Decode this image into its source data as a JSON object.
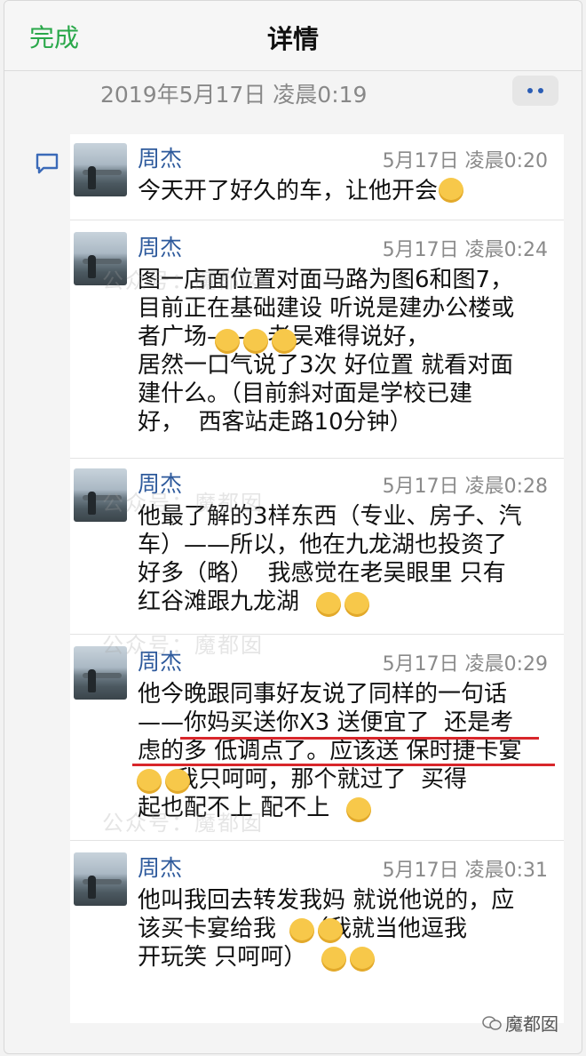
{
  "nav": {
    "done": "完成",
    "title": "详情"
  },
  "header": {
    "date": "2019年5月17日 凌晨0:19"
  },
  "messages": [
    {
      "name": "周杰",
      "time": "5月17日 凌晨0:20",
      "text": "今天开了好久的车，让他开会"
    },
    {
      "name": "周杰",
      "time": "5月17日 凌晨0:24",
      "text": "图一店面位置对面马路为图6和图7，\n目前正在基础建设 听说是建办公楼或\n者广场——  老吴难得说好，\n居然一口气说了3次 好位置 就看对面\n建什么。（目前斜对面是学校已建\n好，  西客站走路10分钟）"
    },
    {
      "name": "周杰",
      "time": "5月17日 凌晨0:28",
      "text": "他最了解的3样东西（专业、房子、汽\n车）——所以，他在九龙湖也投资了\n好多（略）  我感觉在老吴眼里 只有\n红谷滩跟九龙湖"
    },
    {
      "name": "周杰",
      "time": "5月17日 凌晨0:29",
      "text": "他今晚跟同事好友说了同样的一句话\n——你妈买送你X3 送便宜了  还是考\n虑的多 低调点了。应该送 保时捷卡宴\n～  我只呵呵，那个就过了  买得\n起也配不上 配不上"
    },
    {
      "name": "周杰",
      "time": "5月17日 凌晨0:31",
      "text": "他叫我回去转发我妈 就说他说的，应\n该买卡宴给我    （我就当他逗我\n开玩笑 只呵呵）"
    }
  ],
  "watermark": "公众号：魔都囡",
  "brand": "魔都囡"
}
